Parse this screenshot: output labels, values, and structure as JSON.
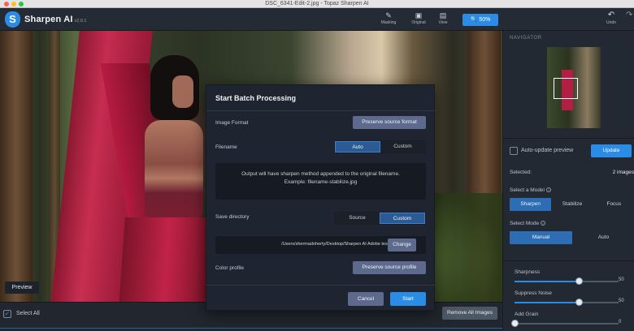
{
  "window": {
    "title": "DSC_6341-Edit-2.jpg - Topaz Sharpen AI"
  },
  "app": {
    "logo_letter": "S",
    "name": "Sharpen AI",
    "version": "v2.0.1"
  },
  "toolbar": {
    "items": [
      {
        "icon": "brush-icon",
        "glyph": "✎",
        "label": "Masking"
      },
      {
        "icon": "image-icon",
        "glyph": "▣",
        "label": "Original"
      },
      {
        "icon": "view-icon",
        "glyph": "▤",
        "label": "View"
      }
    ],
    "zoom_label": "50%",
    "zoom_icon": "magnifier-icon",
    "undo_label": "Undo"
  },
  "canvas": {
    "preview_label": "Preview"
  },
  "bottom": {
    "select_all_label": "Select All",
    "remove_all_label": "Remove All Images"
  },
  "panel": {
    "navigator_label": "NAVIGATOR",
    "auto_update_label": "Auto-update preview",
    "update_label": "Update",
    "selected_label": "Selected:",
    "selected_value": "2 images",
    "select_model_label": "Select a Model",
    "models": [
      "Sharpen",
      "Stabilize",
      "Focus"
    ],
    "select_mode_label": "Select Mode",
    "modes": [
      "Manual",
      "Auto"
    ],
    "sliders": [
      {
        "label": "Sharpness",
        "value": "50",
        "level": 0.62
      },
      {
        "label": "Suppress Noise",
        "value": "50",
        "level": 0.62
      },
      {
        "label": "Add Grain",
        "value": "0",
        "level": 0.0
      }
    ]
  },
  "modal": {
    "title": "Start Batch Processing",
    "image_format_label": "Image Format",
    "image_format_value": "Preserve source format",
    "filename_label": "Filename",
    "filename_options": [
      "Auto",
      "Custom"
    ],
    "info_line1": "Output will have sharpen method appended to the original filename.",
    "info_line2": "Example: filename-stabilize.jpg",
    "save_dir_label": "Save directory",
    "save_dir_options": [
      "Source",
      "Custom"
    ],
    "dir_path": "/Users/shermadoherty/Desktop/Sharpen AI Adobe tests",
    "change_label": "Change",
    "color_profile_label": "Color profile",
    "color_profile_value": "Preserve source profile",
    "cancel_label": "Cancel",
    "start_label": "Start"
  },
  "colors": {
    "accent": "#2b8ce6",
    "panel_bg": "#232932",
    "modal_bg": "#1f2530",
    "fabric_red": "#c21f45"
  }
}
